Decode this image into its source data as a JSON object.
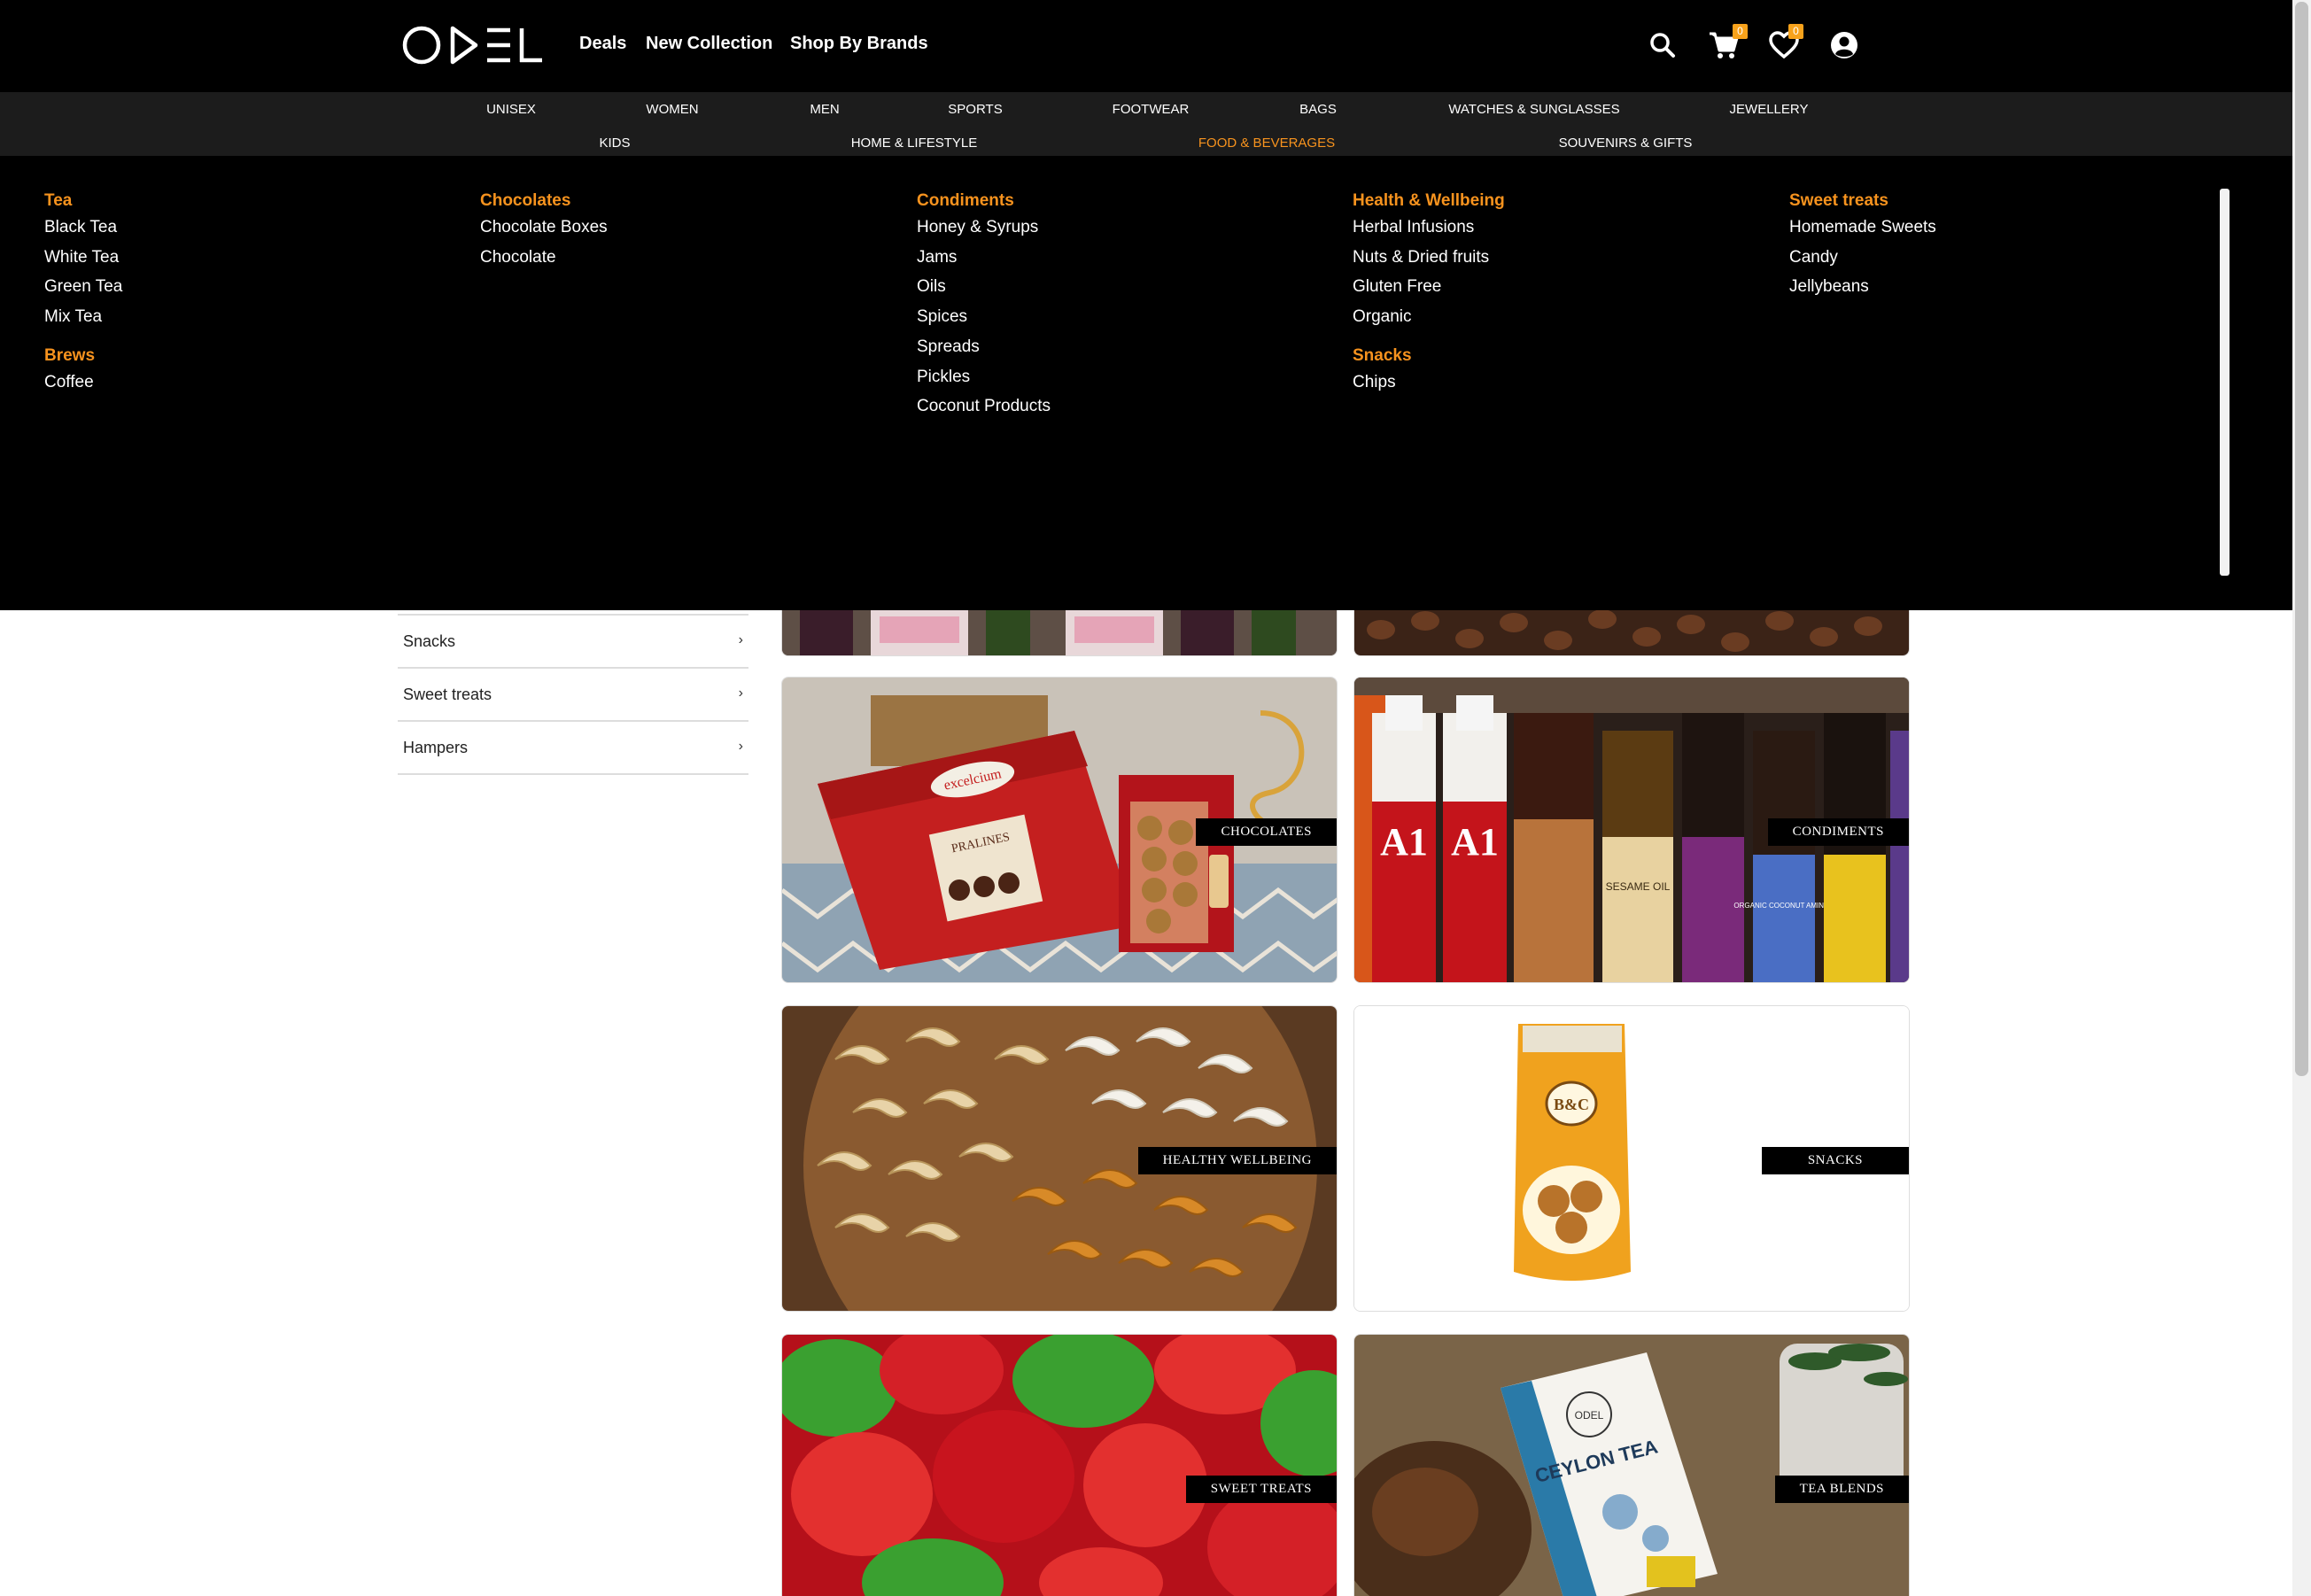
{
  "header": {
    "logo_text": "ODEL",
    "nav": [
      "Deals",
      "New Collection",
      "Shop By Brands"
    ],
    "cart_count": "0",
    "wishlist_count": "0",
    "icons": [
      "search-icon",
      "cart-icon",
      "heart-icon",
      "account-icon"
    ]
  },
  "categories": {
    "row1": [
      "UNISEX",
      "WOMEN",
      "MEN",
      "SPORTS",
      "FOOTWEAR",
      "BAGS",
      "WATCHES & SUNGLASSES",
      "JEWELLERY"
    ],
    "row2": [
      "KIDS",
      "HOME & LIFESTYLE",
      "FOOD & BEVERAGES",
      "SOUVENIRS & GIFTS"
    ],
    "active": "FOOD & BEVERAGES"
  },
  "mega_menu": {
    "tea": {
      "heading": "Tea",
      "items": [
        "Black Tea",
        "White Tea",
        "Green Tea",
        "Mix Tea"
      ]
    },
    "brews": {
      "heading": "Brews",
      "items": [
        "Coffee"
      ]
    },
    "chocolates": {
      "heading": "Chocolates",
      "items": [
        "Chocolate Boxes",
        "Chocolate"
      ]
    },
    "condiments": {
      "heading": "Condiments",
      "items": [
        "Honey & Syrups",
        "Jams",
        "Oils",
        "Spices",
        "Spreads",
        "Pickles",
        "Coconut Products"
      ]
    },
    "health": {
      "heading": "Health & Wellbeing",
      "items": [
        "Herbal Infusions",
        "Nuts & Dried fruits",
        "Gluten Free",
        "Organic"
      ]
    },
    "snacks": {
      "heading": "Snacks",
      "items": [
        "Chips"
      ]
    },
    "sweets": {
      "heading": "Sweet treats",
      "items": [
        "Homemade Sweets",
        "Candy",
        "Jellybeans"
      ]
    }
  },
  "sidebar": {
    "items": [
      {
        "label": "Snacks",
        "chevron": "›"
      },
      {
        "label": "Sweet treats",
        "chevron": "›"
      },
      {
        "label": "Hampers",
        "chevron": "›"
      }
    ]
  },
  "tiles": {
    "chocolates": "CHOCOLATES",
    "condiments": "CONDIMENTS",
    "healthy": "HEALTHY WELLBEING",
    "snacks": "SNACKS",
    "sweet": "SWEET TREATS",
    "tea": "TEA BLENDS"
  },
  "product_text": {
    "pralines": "PRALINES",
    "excelcium": "excelcium",
    "a1": "A1",
    "sesame": "SESAME OIL",
    "aminos": "ORGANIC COCONUT AMINOS",
    "bc": "B&C",
    "ceylon_tea": "CEYLON TEA",
    "odel_small": "ODEL"
  }
}
